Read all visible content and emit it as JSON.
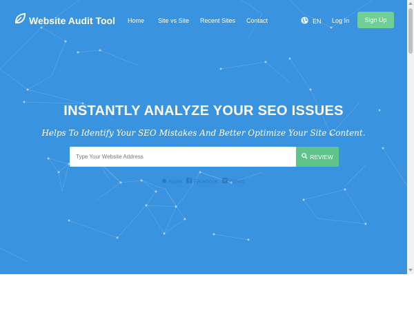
{
  "brand": {
    "name": "Website Audit Tool"
  },
  "nav": {
    "links": [
      "Home",
      "Site vs Site",
      "Recent Sites",
      "Contact"
    ],
    "language": "EN",
    "login": "Log In",
    "signup": "Sign Up"
  },
  "hero": {
    "headline": "INSTANTLY ANALYZE YOUR SEO ISSUES",
    "subheadline": "Helps To Identify Your SEO Mistakes And Better Optimize Your Site Content.",
    "search_placeholder": "Type Your Website Address",
    "review_label": "REVIEW",
    "examples": [
      "Apple",
      "Facebook",
      "Yahoo"
    ]
  },
  "colors": {
    "hero_bg": "#3a93de",
    "accent_green": "#6fcf97",
    "review_green": "#5fc48a"
  },
  "icons": {
    "logo": "leaf-icon",
    "language": "globe-icon",
    "review": "search-icon",
    "examples": [
      "apple-icon",
      "facebook-icon",
      "yahoo-icon"
    ]
  }
}
